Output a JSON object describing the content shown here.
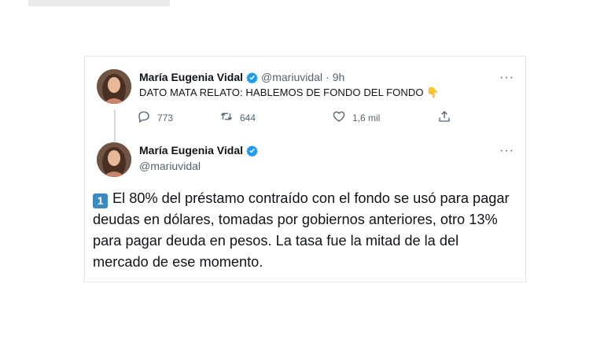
{
  "tweet1": {
    "author_name": "María Eugenia Vidal",
    "handle": "@mariuvidal",
    "separator": "·",
    "time": "9h",
    "text": "DATO MATA RELATO: HABLEMOS DE FONDO DEL FONDO",
    "emoji": "👇",
    "replies": "773",
    "retweets": "644",
    "likes": "1,6 mil",
    "more": "···"
  },
  "tweet2": {
    "author_name": "María Eugenia Vidal",
    "handle": "@mariuvidal",
    "more": "···",
    "keycap": "1",
    "text": "El 80% del préstamo contraído con el fondo se usó para pagar deudas en dólares, tomadas por gobiernos anteriores, otro 13% para pagar deuda en pesos. La tasa fue la mitad de la del mercado de ese momento."
  },
  "icons": {
    "verified": "verified-badge-icon",
    "reply": "reply-icon",
    "retweet": "retweet-icon",
    "like": "heart-icon",
    "share": "share-icon",
    "more": "more-icon"
  },
  "colors": {
    "verified": "#1d9bf0",
    "text": "#0f1419",
    "secondary": "#536471",
    "keycap": "#3b88c3"
  }
}
